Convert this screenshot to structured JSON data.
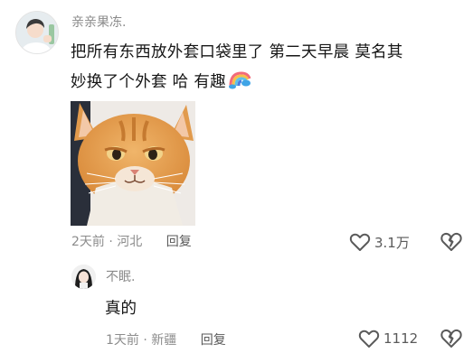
{
  "comment": {
    "username": "亲亲果冻.",
    "text_line1": "把所有东西放外套口袋里了  第二天早晨 莫名其",
    "text_line2": "妙换了个外套 哈 有趣",
    "emoji": "rainbow-emoji",
    "image": "orange-cat-meme",
    "time": "2天前",
    "separator": "·",
    "location": "河北",
    "reply_label": "回复",
    "like_count": "3.1万",
    "colors": {
      "cat_fur": "#e8a24e",
      "cat_white": "#f1ece4",
      "username": "#8a8a8a"
    }
  },
  "reply": {
    "username": "不眠.",
    "text": "真的",
    "time": "1天前",
    "separator": "·",
    "location": "新疆",
    "reply_label": "回复",
    "like_count": "1112"
  }
}
